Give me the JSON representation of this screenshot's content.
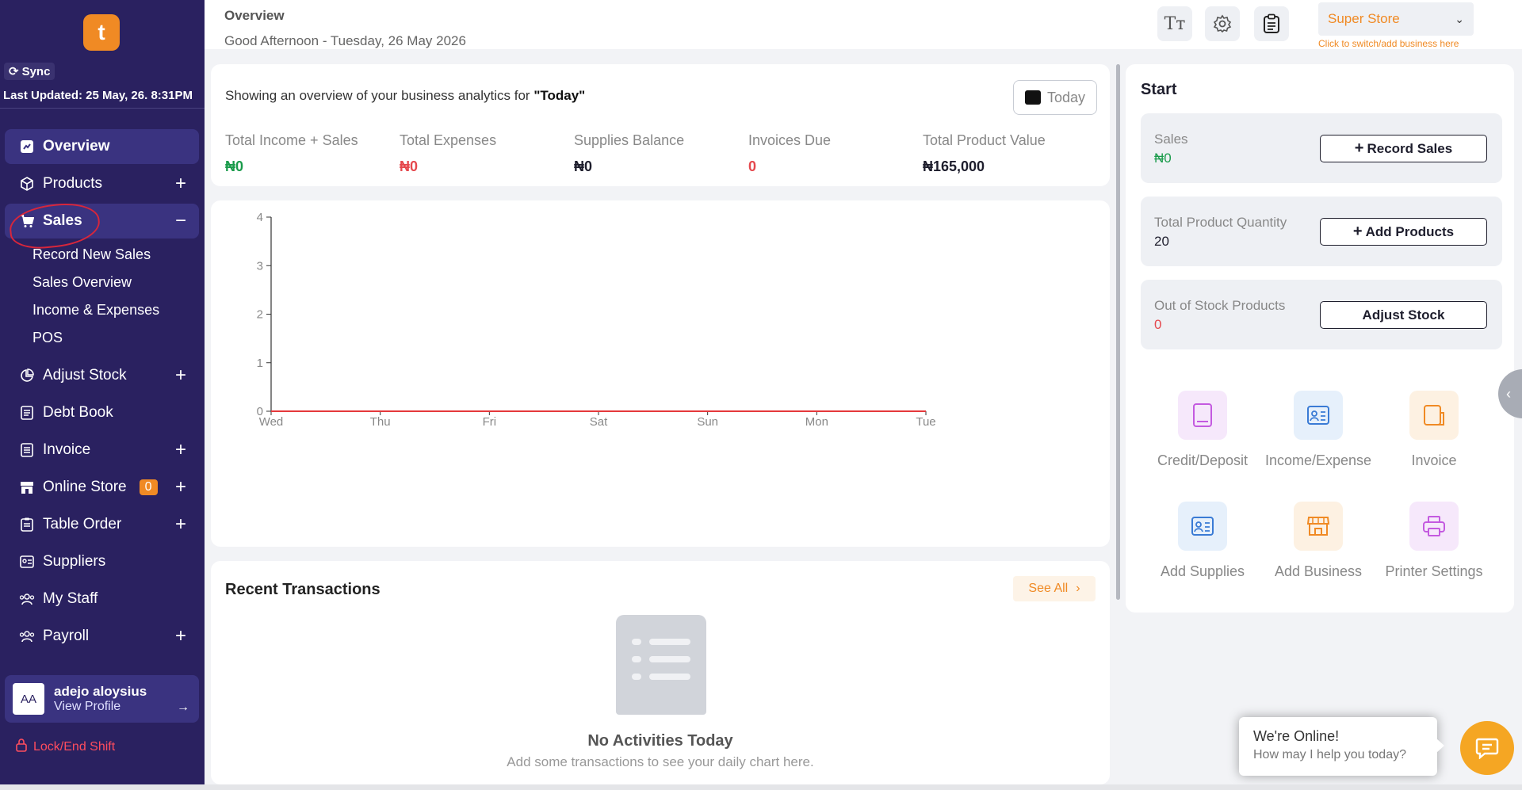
{
  "sidebar": {
    "sync_label": "Sync",
    "last_updated": "Last Updated: 25 May, 26. 8:31PM",
    "items": [
      {
        "label": "Overview"
      },
      {
        "label": "Products",
        "action": "+"
      },
      {
        "label": "Sales",
        "action": "−"
      },
      {
        "label": "Adjust Stock",
        "action": "+"
      },
      {
        "label": "Debt Book"
      },
      {
        "label": "Invoice",
        "action": "+"
      },
      {
        "label": "Online Store",
        "badge": "0",
        "action": "+"
      },
      {
        "label": "Table Order",
        "action": "+"
      },
      {
        "label": "Suppliers"
      },
      {
        "label": "My Staff"
      },
      {
        "label": "Payroll",
        "action": "+"
      }
    ],
    "sales_sub": [
      "Record New Sales",
      "Sales Overview",
      "Income & Expenses",
      "POS"
    ],
    "profile": {
      "initials": "AA",
      "name": "adejo aloysius",
      "link": "View Profile"
    },
    "lock_label": "Lock/End Shift"
  },
  "header": {
    "title": "Overview",
    "greeting": "Good Afternoon - Tuesday, 26 May 2026",
    "store": "Super Store",
    "store_hint": "Click to switch/add business here"
  },
  "analytics": {
    "heading_prefix": "Showing an overview of your business analytics for ",
    "heading_period": "\"Today\"",
    "today_label": "Today",
    "stats": [
      {
        "label": "Total Income + Sales",
        "value": "₦0",
        "color": "#1a9b4b"
      },
      {
        "label": "Total Expenses",
        "value": "₦0",
        "color": "#e5484d"
      },
      {
        "label": "Supplies Balance",
        "value": "₦0",
        "color": "#1e1e2d"
      },
      {
        "label": "Invoices Due",
        "value": "0",
        "color": "#e5484d"
      },
      {
        "label": "Total Product Value",
        "value": "₦165,000",
        "color": "#1e1e2d"
      }
    ]
  },
  "chart_data": {
    "type": "line",
    "x": [
      "Wed",
      "Thu",
      "Fri",
      "Sat",
      "Sun",
      "Mon",
      "Tue"
    ],
    "series": [
      {
        "values": [
          0,
          0,
          0,
          0,
          0,
          0,
          0
        ],
        "color": "#e5383b"
      }
    ],
    "yticks": [
      0,
      1,
      2,
      3,
      4
    ],
    "ylim": [
      0,
      4
    ],
    "grid": false
  },
  "transactions": {
    "title": "Recent Transactions",
    "see_all": "See All",
    "empty_title": "No Activities Today",
    "empty_sub": "Add some transactions to see your daily chart here."
  },
  "start": {
    "title": "Start",
    "actions": [
      {
        "label": "Sales",
        "value": "₦0",
        "value_color": "#1a9b4b",
        "button": "Record Sales",
        "plus": true
      },
      {
        "label": "Total Product Quantity",
        "value": "20",
        "value_color": "#1e1e2d",
        "button": "Add Products",
        "plus": true
      },
      {
        "label": "Out of Stock Products",
        "value": "0",
        "value_color": "#e5484d",
        "button": "Adjust Stock",
        "plus": false
      }
    ],
    "quick_links": [
      {
        "label": "Credit/Deposit",
        "icon": "book-icon",
        "bg": "#f6e8fb",
        "color": "#c45ae0"
      },
      {
        "label": "Income/Expense",
        "icon": "id-card-icon",
        "bg": "#e6f0fb",
        "color": "#3a7bd5"
      },
      {
        "label": "Invoice",
        "icon": "document-icon",
        "bg": "#fdf1e2",
        "color": "#f08a24"
      },
      {
        "label": "Add Supplies",
        "icon": "id-card-icon",
        "bg": "#e6f0fb",
        "color": "#3a7bd5"
      },
      {
        "label": "Add Business",
        "icon": "store-icon",
        "bg": "#fdf1e2",
        "color": "#f08a24"
      },
      {
        "label": "Printer Settings",
        "icon": "printer-icon",
        "bg": "#f6e8fb",
        "color": "#c45ae0"
      }
    ]
  },
  "chat": {
    "title": "We're Online!",
    "subtitle": "How may I help you today?"
  }
}
